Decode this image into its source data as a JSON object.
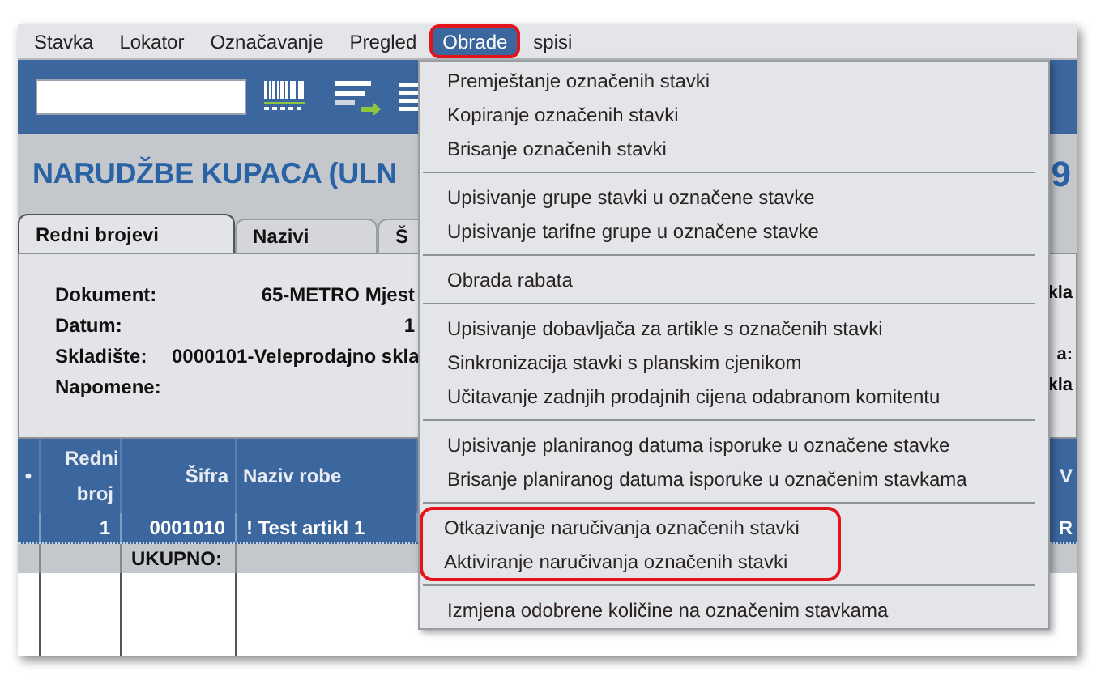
{
  "menu_bar": [
    {
      "label": "Stavka",
      "selected": false,
      "highlighted": false
    },
    {
      "label": "Lokator",
      "selected": false,
      "highlighted": false
    },
    {
      "label": "Označavanje",
      "selected": false,
      "highlighted": false
    },
    {
      "label": "Pregled",
      "selected": false,
      "highlighted": false
    },
    {
      "label": "Obrade",
      "selected": true,
      "highlighted": true
    },
    {
      "label": "spisi",
      "selected": false,
      "highlighted": false
    }
  ],
  "title": "NARUDŽBE KUPACA (ULN",
  "title_tail": "9",
  "tabs": [
    {
      "label": "Redni brojevi",
      "selected": true
    },
    {
      "label": "Nazivi",
      "selected": false
    },
    {
      "label": "Š",
      "selected": false
    }
  ],
  "form": [
    {
      "label": "Dokument:",
      "value": "65-METRO Mjest",
      "tail": "kla"
    },
    {
      "label": "Datum:",
      "value": "1"
    },
    {
      "label": "Skladište:",
      "value": "0000101-Veleprodajno skla",
      "tail": "a:"
    },
    {
      "label": "Napomene:",
      "tail": "kla"
    }
  ],
  "table": {
    "columns": [
      "•",
      "Redni broj",
      "Šifra",
      "Naziv robe"
    ],
    "column_tail": "V",
    "rows": [
      {
        "cells": [
          "",
          "1",
          "0001010",
          "! Test artikl 1"
        ],
        "selected": true,
        "tail": "R"
      }
    ],
    "total_label": "UKUPNO:"
  },
  "dropdown": {
    "groups": [
      {
        "highlighted": false,
        "items": [
          "Premještanje označenih stavki",
          "Kopiranje označenih stavki",
          "Brisanje označenih stavki"
        ]
      },
      {
        "highlighted": false,
        "items": [
          "Upisivanje grupe stavki u označene stavke",
          "Upisivanje tarifne grupe u označene stavke"
        ]
      },
      {
        "highlighted": false,
        "items": [
          "Obrada rabata"
        ]
      },
      {
        "highlighted": false,
        "items": [
          "Upisivanje dobavljača za artikle s označenih stavki",
          "Sinkronizacija stavki s planskim cjenikom",
          "Učitavanje zadnjih prodajnih cijena odabranom komitentu"
        ]
      },
      {
        "highlighted": false,
        "items": [
          "Upisivanje planiranog datuma isporuke u označene stavke",
          "Brisanje planiranog datuma isporuke u označenim stavkama"
        ]
      },
      {
        "highlighted": true,
        "items": [
          "Otkazivanje naručivanja označenih stavki",
          "Aktiviranje naručivanja označenih stavki"
        ]
      },
      {
        "highlighted": false,
        "items": [
          "Izmjena odobrene količine na označenim stavkama"
        ]
      }
    ]
  }
}
